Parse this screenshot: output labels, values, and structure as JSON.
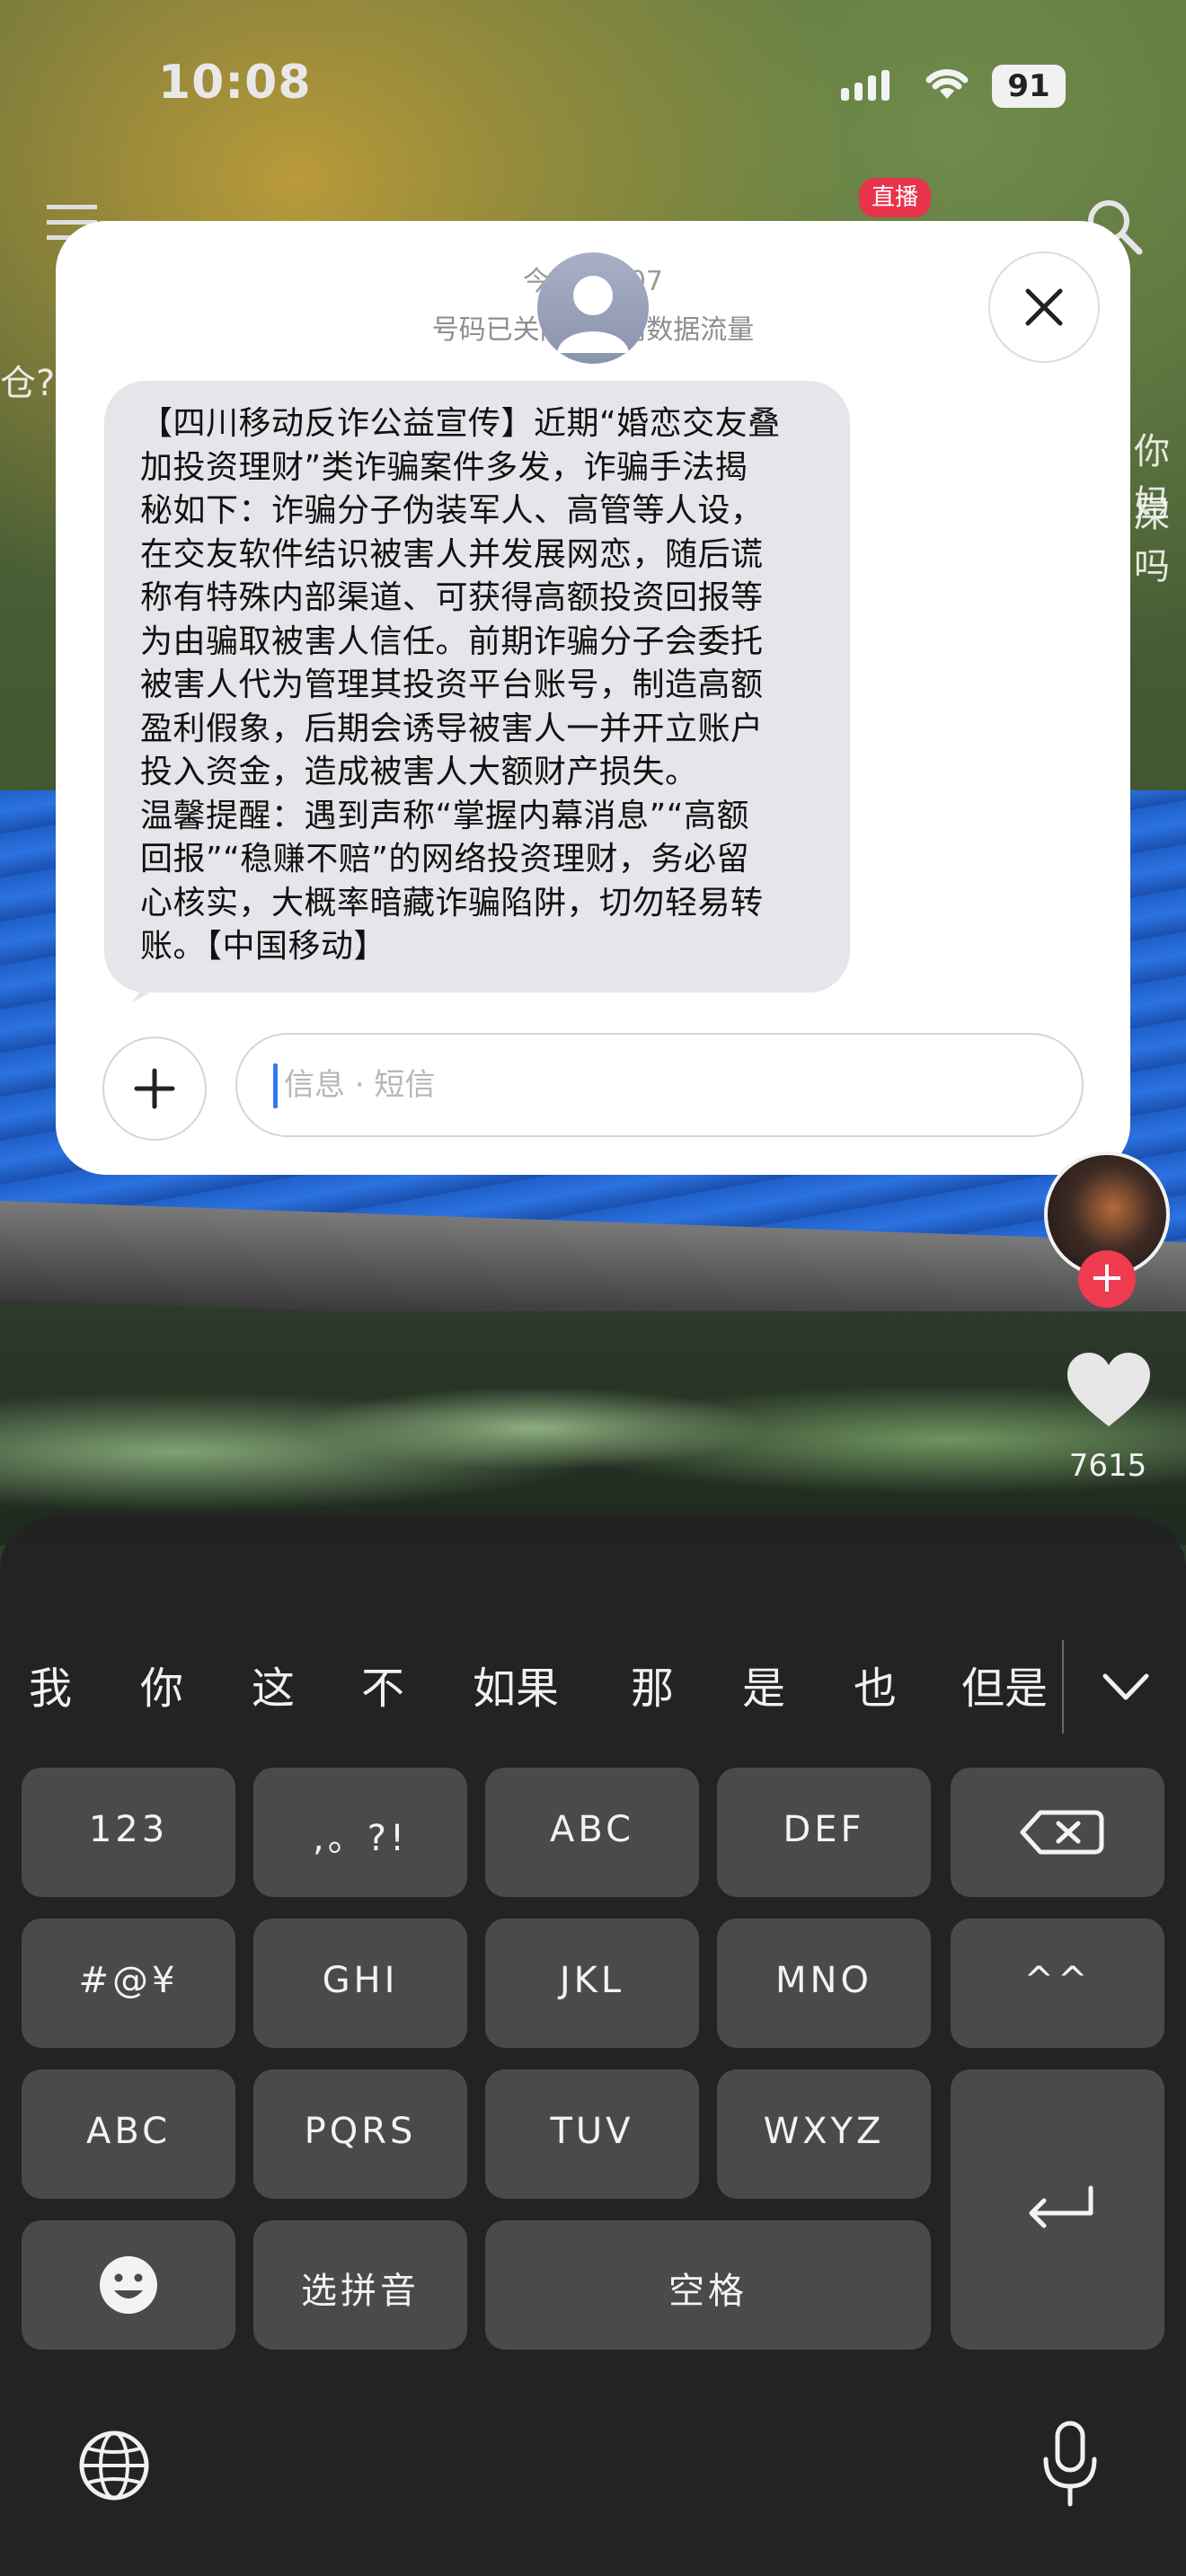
{
  "status_bar": {
    "time": "10:08",
    "battery": "91"
  },
  "app_nav": {
    "live_badge": "直播"
  },
  "side_texts": {
    "left": "仓?",
    "right_1": "你妈",
    "right_2": "屎吗"
  },
  "sms": {
    "header_line1": "今天 10:07",
    "header_line2": "号码已关闭 · 蜂窝数据流量",
    "message": "【四川移动反诈公益宣传】近期“婚恋交友叠\n加投资理财”类诈骗案件多发，诈骗手法揭\n秘如下：诈骗分子伪装军人、高管等人设，\n在交友软件结识被害人并发展网恋，随后谎\n称有特殊内部渠道、可获得高额投资回报等\n为由骗取被害人信任。前期诈骗分子会委托\n被害人代为管理其投资平台账号，制造高额\n盈利假象，后期会诱导被害人一并开立账户\n投入资金，造成被害人大额财产损失。\n温馨提醒：遇到声称“掌握内幕消息”“高额\n回报”“稳赚不赔”的网络投资理财，务必留\n心核实，大概率暗藏诈骗陷阱，切勿轻易转\n账。【中国移动】",
    "input_placeholder": "信息 · 短信"
  },
  "video": {
    "like_count": "7615"
  },
  "keyboard": {
    "candidates": [
      "我",
      "你",
      "这",
      "不",
      "如果",
      "那",
      "是",
      "也",
      "但是"
    ],
    "rows": {
      "r1": [
        "123",
        ",。?!",
        "ABC",
        "DEF"
      ],
      "r2": [
        "#@¥",
        "GHI",
        "JKL",
        "MNO",
        "^^"
      ],
      "r3": [
        "ABC",
        "PQRS",
        "TUV",
        "WXYZ"
      ],
      "r4": [
        "选拼音",
        "空格"
      ]
    }
  },
  "colors": {
    "accent_red": "#ef3b4f",
    "bubble_gray": "#e5e5ea",
    "caret_blue": "#3478f6",
    "key_bg": "#4a4a4c"
  }
}
